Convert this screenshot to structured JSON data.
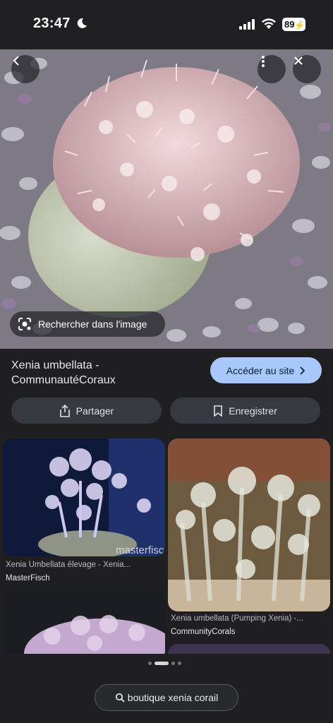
{
  "status_bar": {
    "time": "23:47",
    "battery": "89"
  },
  "hero": {
    "search_image_label": "Rechercher dans l'image"
  },
  "result": {
    "title_line1": "Xenia umbellata -",
    "title_line2": "CommunautéCoraux",
    "visit_label": "Accéder au site"
  },
  "actions": {
    "share_label": "Partager",
    "save_label": "Enregistrer"
  },
  "grid": {
    "items": [
      {
        "caption": "Xenia Umbellata élevage - Xenia...",
        "source": "MasterFisch",
        "watermark": "masterfisc"
      },
      {
        "caption": "Xenia umbellata (Pumping Xenia) -...",
        "source": "CommunityCorals"
      }
    ]
  },
  "bottom": {
    "query_label": "boutique xenia corail"
  },
  "colors": {
    "accent_button": "#a8c7fa",
    "background": "#1f1f21",
    "chip": "#36393f"
  }
}
